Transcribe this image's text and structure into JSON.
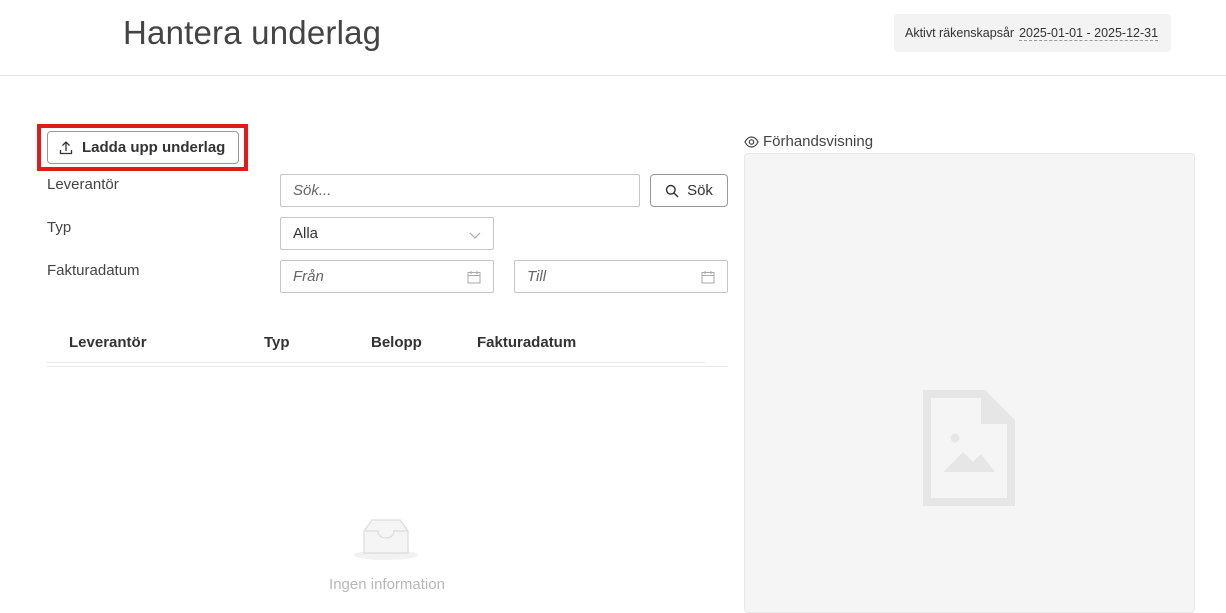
{
  "header": {
    "title": "Hantera underlag",
    "fiscal_year_label": "Aktivt räkenskapsår",
    "fiscal_year_value": "2025-01-01 - 2025-12-31"
  },
  "toolbar": {
    "upload_label": "Ladda upp underlag",
    "upload_icon": "upload-icon",
    "highlight_color": "#e01b1b"
  },
  "filters": {
    "supplier_label": "Leverantör",
    "supplier_placeholder": "Sök...",
    "search_button": "Sök",
    "type_label": "Typ",
    "type_value": "Alla",
    "date_label": "Fakturadatum",
    "date_from_placeholder": "Från",
    "date_to_placeholder": "Till"
  },
  "table": {
    "columns": [
      "Leverantör",
      "Typ",
      "Belopp",
      "Fakturadatum"
    ],
    "rows": [],
    "empty_text": "Ingen information"
  },
  "preview": {
    "label": "Förhandsvisning"
  }
}
